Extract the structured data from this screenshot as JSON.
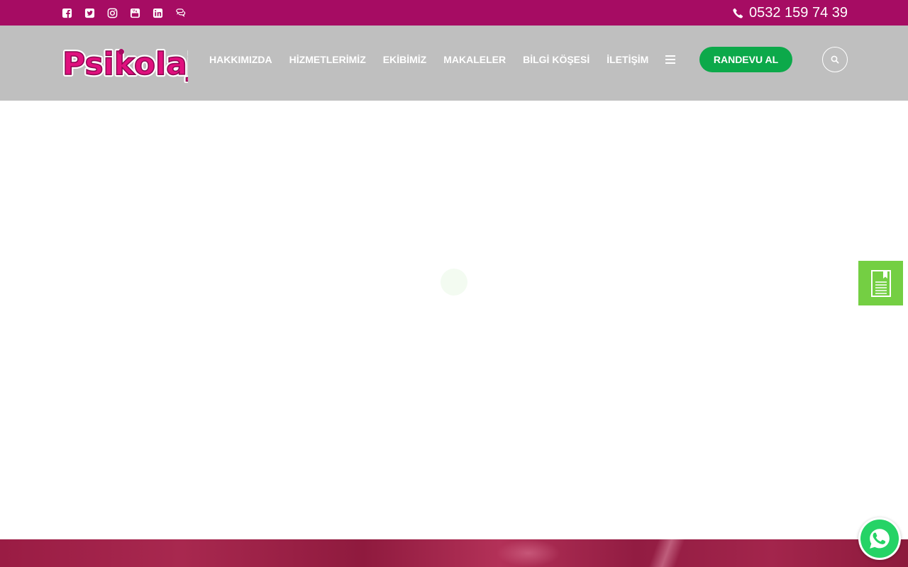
{
  "colors": {
    "topbar": "#a60c63",
    "header": "#bfbfbf",
    "randevu_button": "#0ca94a",
    "side_tab": "#74cf43",
    "whatsapp": "#25d366",
    "logo_pink": "#e0107e"
  },
  "topbar": {
    "social_icons": [
      "facebook-icon",
      "twitter-icon",
      "instagram-icon",
      "youtube-icon",
      "linkedin-icon",
      "chat-icon"
    ],
    "phone": "0532 159 74 39"
  },
  "header": {
    "logo_text": "Psikolaj",
    "nav": {
      "about": "HAKKIMIZDA",
      "services": "HİZMETLERİMİZ",
      "team": "EKİBİMİZ",
      "articles": "MAKALELER",
      "info": "BİLGİ KÖŞESİ",
      "contact": "İLETİŞİM"
    },
    "randevu_label": "RANDEVU AL"
  },
  "floating": {
    "side_tab_icon": "document-icon",
    "whatsapp_icon": "whatsapp-icon"
  }
}
